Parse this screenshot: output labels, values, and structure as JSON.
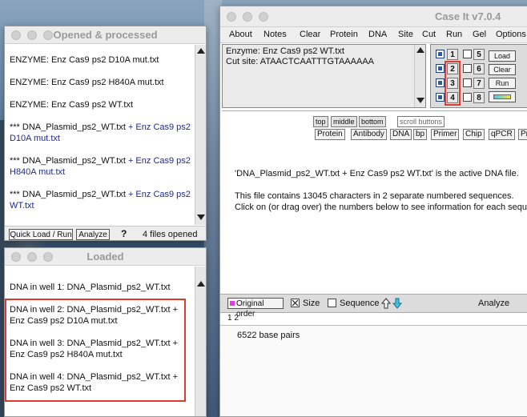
{
  "opened_window": {
    "title": "Opened & processed",
    "items": [
      {
        "text": "ENZYME: Enz Cas9 ps2 D10A mut.txt"
      },
      {
        "text": "ENZYME: Enz Cas9 ps2 H840A mut.txt"
      },
      {
        "text": "ENZYME: Enz Cas9 ps2 WT.txt"
      },
      {
        "prefix": "*** DNA_Plasmid_ps2_WT.txt",
        "suffix": " + Enz Cas9 ps2",
        "line2": "D10A mut.txt"
      },
      {
        "prefix": "*** DNA_Plasmid_ps2_WT.txt",
        "suffix": " + Enz Cas9 ps2",
        "line2": "H840A mut.txt"
      },
      {
        "prefix": "*** DNA_Plasmid_ps2_WT.txt",
        "suffix": " + Enz Cas9 ps2",
        "line2": "WT.txt"
      }
    ],
    "quick_load_label": "Quick Load / Run",
    "analyze_label": "Analyze",
    "help_label": "?",
    "files_opened": "4  files opened"
  },
  "loaded_window": {
    "title": "Loaded",
    "well1": "DNA in well 1:  DNA_Plasmid_ps2_WT.txt",
    "wells": [
      {
        "line1": "DNA in well 2:  DNA_Plasmid_ps2_WT.txt +",
        "line2": "Enz Cas9 ps2 D10A mut.txt"
      },
      {
        "line1": "DNA in well 3:  DNA_Plasmid_ps2_WT.txt +",
        "line2": "Enz Cas9 ps2 H840A mut.txt"
      },
      {
        "line1": "DNA in well 4:  DNA_Plasmid_ps2_WT.txt +",
        "line2": "Enz Cas9 ps2 WT.txt"
      }
    ]
  },
  "main_window": {
    "title": "Case It v7.0.4",
    "menu": [
      "About",
      "Notes",
      "Clear",
      "Protein",
      "DNA",
      "Site",
      "Cut",
      "Run",
      "Gel",
      "Options"
    ],
    "enzyme_line": "Enzyme: Enz Cas9 ps2 WT.txt",
    "cut_site_line": "Cut site: ATAACTCAATTTGTAAAAAA",
    "wells_left": [
      "1",
      "2",
      "3",
      "4"
    ],
    "wells_right": [
      "5",
      "6",
      "7",
      "8"
    ],
    "actions": {
      "load": "Load",
      "clear": "Clear",
      "run": "Run"
    },
    "tabs_top": [
      "top",
      "middle",
      "bottom",
      "scroll buttons"
    ],
    "tools": [
      "Protein",
      "Antibody",
      "DNA",
      "bp",
      "Primer",
      "Chip",
      "qPCR",
      "Pr"
    ],
    "info1": "'DNA_Plasmid_ps2_WT.txt + Enz Cas9 ps2 WT.txt' is the active DNA file.",
    "info2": "This file contains 13045 characters in 2 separate numbered sequences.",
    "info3": "Click on (or drag over) the numbers below to see information for each sequence",
    "bottom_toolbar": {
      "original_order": "Original order",
      "size": "Size",
      "sequence": "Sequence",
      "analyze": "Analyze"
    },
    "sequence_numbers": "1  2",
    "base_pairs": "6522 base pairs"
  },
  "colors": {
    "accent_red": "#e03a2e",
    "link_blue": "#1f2a8c"
  }
}
